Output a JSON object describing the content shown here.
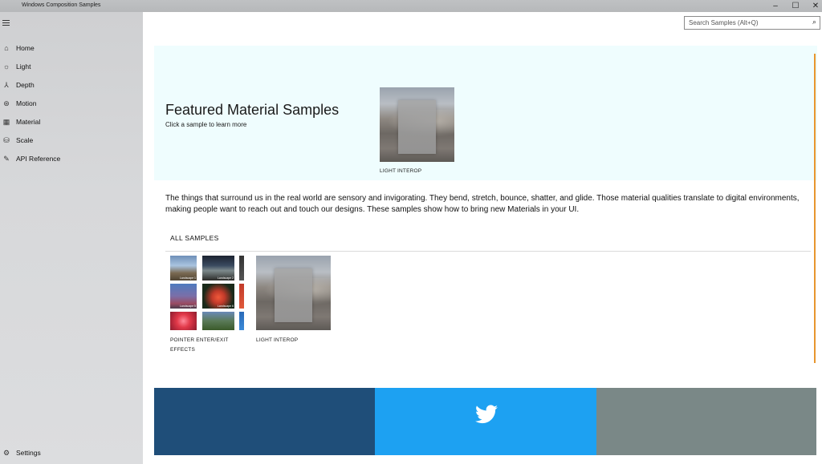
{
  "window": {
    "title": "Windows Composition Samples",
    "controls": {
      "minimize": "–",
      "maximize": "☐",
      "close": "✕"
    }
  },
  "sidebar": {
    "menu_icon": "hamburger-icon",
    "items": [
      {
        "label": "Home",
        "icon": "home-icon"
      },
      {
        "label": "Light",
        "icon": "light-icon"
      },
      {
        "label": "Depth",
        "icon": "depth-icon"
      },
      {
        "label": "Motion",
        "icon": "motion-icon"
      },
      {
        "label": "Material",
        "icon": "material-icon"
      },
      {
        "label": "Scale",
        "icon": "scale-icon"
      },
      {
        "label": "API Reference",
        "icon": "pencil-icon"
      }
    ],
    "settings": {
      "label": "Settings",
      "icon": "gear-icon"
    }
  },
  "search": {
    "placeholder": "Search Samples (Alt+Q)",
    "icon": "search-icon"
  },
  "featured": {
    "title": "Featured Material Samples",
    "subtitle": "Click a sample to learn more",
    "tile_label": "LIGHT INTEROP"
  },
  "intro_text": "The things that surround us in the real world are sensory and invigorating. They bend, stretch, bounce, shatter, and glide. Those material qualities translate to digital environments, making people want to reach out and touch our designs.  These samples show how to bring new Materials in your UI.",
  "all_samples": {
    "header": "ALL SAMPLES",
    "tiles": [
      {
        "label": "POINTER ENTER/EXIT EFFECTS"
      },
      {
        "label": "LIGHT INTEROP"
      }
    ],
    "thumb_captions": [
      "Landscape 1",
      "Landscape 2",
      "Landscape 5",
      "Landscape 6"
    ]
  },
  "footer": {
    "colors": {
      "left": "#1f4e79",
      "middle": "#1da1f2",
      "right": "#7a8887"
    },
    "middle_icon": "twitter-icon"
  },
  "accent_color": "#e8962e"
}
